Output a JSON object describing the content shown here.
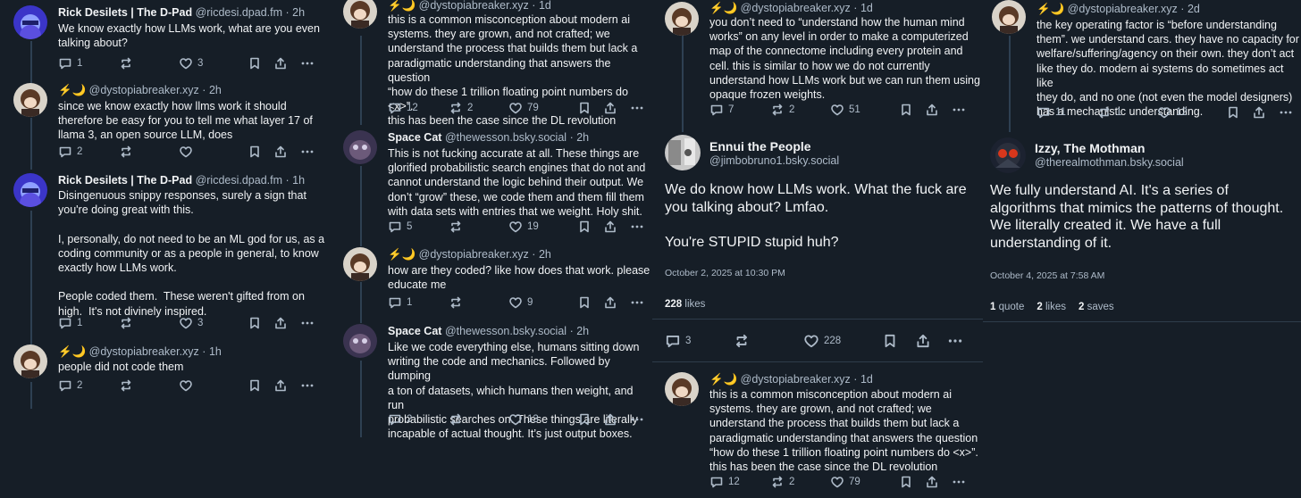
{
  "user": {
    "rick": {
      "name": "Rick Desilets | The D-Pad",
      "handle": "@ricdesi.dpad.fm"
    },
    "dysto": {
      "name": "⚡🌙",
      "handle": "@dystopiabreaker.xyz"
    },
    "space": {
      "name": "Space Cat",
      "handle": "@thewesson.bsky.social"
    },
    "ennui": {
      "name": "Ennui the People",
      "handle": "@jimbobruno1.bsky.social"
    },
    "izzy": {
      "name": "Izzy, The Mothman",
      "handle": "@therealmothman.bsky.social"
    }
  },
  "sep": "·",
  "panel1": {
    "posts": [
      {
        "time": "2h",
        "text": "We know exactly how LLMs work, what are you even\ntalking about?",
        "replies": "1",
        "reposts": "",
        "likes": "3"
      },
      {
        "time": "2h",
        "text": "since we know exactly how llms work it should\ntherefore be easy for you to tell me what layer 17 of\nllama 3, an open source LLM, does",
        "replies": "2",
        "reposts": "",
        "likes": ""
      },
      {
        "time": "1h",
        "text": "Disingenuous snippy responses, surely a sign that\nyou're doing great with this.\n\nI, personally, do not need to be an ML god for us, as a\ncoding community or as a people in general, to know\nexactly how LLMs work.\n\nPeople coded them.  These weren't gifted from on\nhigh.  It's not divinely inspired.",
        "replies": "1",
        "reposts": "",
        "likes": "3"
      },
      {
        "time": "1h",
        "text": "people did not code them",
        "replies": "2",
        "reposts": "",
        "likes": ""
      }
    ]
  },
  "panel2": {
    "posts": [
      {
        "time": "1d",
        "text": "this is a common misconception about modern ai\nsystems. they are grown, and not crafted; we\nunderstand the process that builds them but lack a\nparadigmatic understanding that answers the question\n“how do these 1 trillion floating point numbers do <x>”.\nthis has been the case since the DL revolution",
        "replies": "12",
        "reposts": "2",
        "likes": "79"
      },
      {
        "time": "2h",
        "text": "This is not fucking accurate at all. These things are\nglorified probabilistic search engines that do not and\ncannot understand the logic behind their output. We\ndon’t “grow” these, we code them and them fill them\nwith data sets with entries that we weight. Holy shit.",
        "replies": "5",
        "reposts": "",
        "likes": "19"
      },
      {
        "time": "2h",
        "text": "how are they coded? like how does that work. please\neducate me",
        "replies": "1",
        "reposts": "",
        "likes": "9"
      },
      {
        "time": "2h",
        "text": "Like we code everything else, humans sitting down\nwriting the code and mechanics. Followed by dumping\na ton of datasets, which humans then weight, and run\nprobabilistic searches on. These things are literally\nincapable of actual thought. It’s just output boxes.",
        "replies": "2",
        "reposts": "",
        "likes": "13"
      }
    ]
  },
  "panel3": {
    "top": {
      "time": "1d",
      "text": "you don’t need to “understand how the human mind\nworks” on any level in order to make a computerized\nmap of the connectome including every protein and\ncell. this is similar to how we do not currently\nunderstand how LLMs work but we can run them using\nopaque frozen weights.",
      "replies": "7",
      "reposts": "2",
      "likes": "51"
    },
    "main": {
      "text": "We do know how LLMs work. What the fuck are\nyou talking about? Lmfao.\n\nYou're STUPID stupid huh?",
      "date": "October 2, 2025 at 10:30 PM",
      "likes_count": "228",
      "likes_label": "likes",
      "replies": "3",
      "likes": "228"
    },
    "reply": {
      "time": "1d",
      "text": "this is a common misconception about modern ai\nsystems. they are grown, and not crafted; we\nunderstand the process that builds them but lack a\nparadigmatic understanding that answers the question\n“how do these 1 trillion floating point numbers do <x>”.\nthis has been the case since the DL revolution",
      "replies": "12",
      "reposts": "2",
      "likes": "79"
    }
  },
  "panel4": {
    "top": {
      "time": "2d",
      "text": "the key operating factor is “before understanding\nthem”. we understand cars. they have no capacity for\nwelfare/suffering/agency on their own. they don’t act\nlike they do. modern ai systems do sometimes act like\nthey do, and no one (not even the model designers)\nhas a mechanistic understanding.",
      "replies": "11",
      "reposts": "1",
      "likes": "12"
    },
    "main": {
      "text": "We fully understand AI. It's a series of\nalgorithms that mimics the patterns of thought.\nWe literally created it. We have a full\nunderstanding of it.",
      "date": "October 4, 2025 at 7:58 AM",
      "quotes_count": "1",
      "quotes_label": "quote",
      "likes_count": "2",
      "likes_label": "likes",
      "saves_count": "2",
      "saves_label": "saves"
    }
  },
  "colors": {
    "bg": "#161e27",
    "text": "#f1f3f5",
    "muted": "#aebbc9",
    "thread": "#2e4052"
  }
}
